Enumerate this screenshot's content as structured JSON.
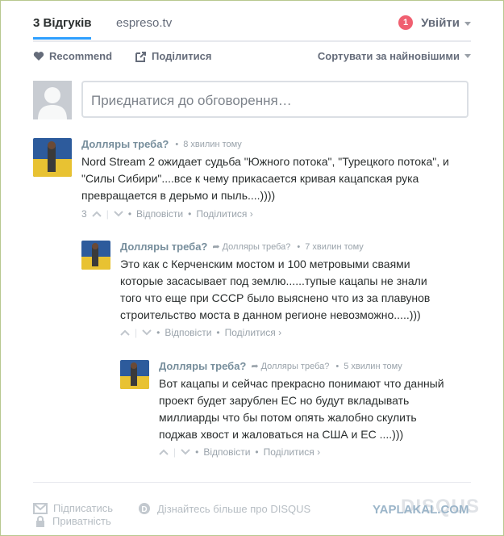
{
  "tabs": {
    "comments": "3 Відгуків",
    "site": "espreso.tv"
  },
  "login": {
    "badge": "1",
    "label": "Увійти"
  },
  "toolbar": {
    "recommend": "Recommend",
    "share": "Поділитися",
    "sort": "Сортувати за найновішими"
  },
  "composer": {
    "placeholder": "Приєднатися до обговорення…"
  },
  "comments": [
    {
      "author": "Долляры треба?",
      "reply_to": "",
      "time": "8 хвилин тому",
      "body_lines": [
        "Nord Stream 2 ожидает судьба \"Южного потока\", \"Турецкого потока\", и",
        "\"Силы Сибири\"....все к чему прикасается кривая кацапская рука",
        "превращается в дерьмо и пыль....))))"
      ],
      "votes": "3",
      "reply": "Відповісти",
      "share": "Поділитися ›"
    },
    {
      "author": "Долляры треба?",
      "reply_to": "Долляры треба?",
      "time": "7 хвилин тому",
      "body_lines": [
        "Это как с Керченским мостом и 100 метровыми сваями",
        "которые засасывает под землю......тупые кацапы не знали",
        "того что еще при СССР было выяснено что из за плавунов",
        "строительство моста в данном регионе невозможно.....)))"
      ],
      "votes": "",
      "reply": "Відповісти",
      "share": "Поділитися ›"
    },
    {
      "author": "Долляры треба?",
      "reply_to": "Долляры треба?",
      "time": "5 хвилин тому",
      "body_lines": [
        "Вот кацапы и сейчас прекрасно понимают что данный",
        "проект будет зарублен ЕС но будут вкладывать",
        "миллиарды что бы потом опять жалобно скулить",
        "поджав хвост и жаловаться на США и ЕС ....)))"
      ],
      "votes": "",
      "reply": "Відповісти",
      "share": "Поділитися ›"
    }
  ],
  "bottom": {
    "subscribe": "Підписатись",
    "learn_more": "Дізнайтесь більше про DISQUS",
    "privacy": "Приватність",
    "logo": "DISQUS"
  },
  "watermark": "YAPLAKAL.COM",
  "colors": {
    "accent": "#2e9fff",
    "badge": "#f05f70",
    "author": "#778e9c"
  }
}
